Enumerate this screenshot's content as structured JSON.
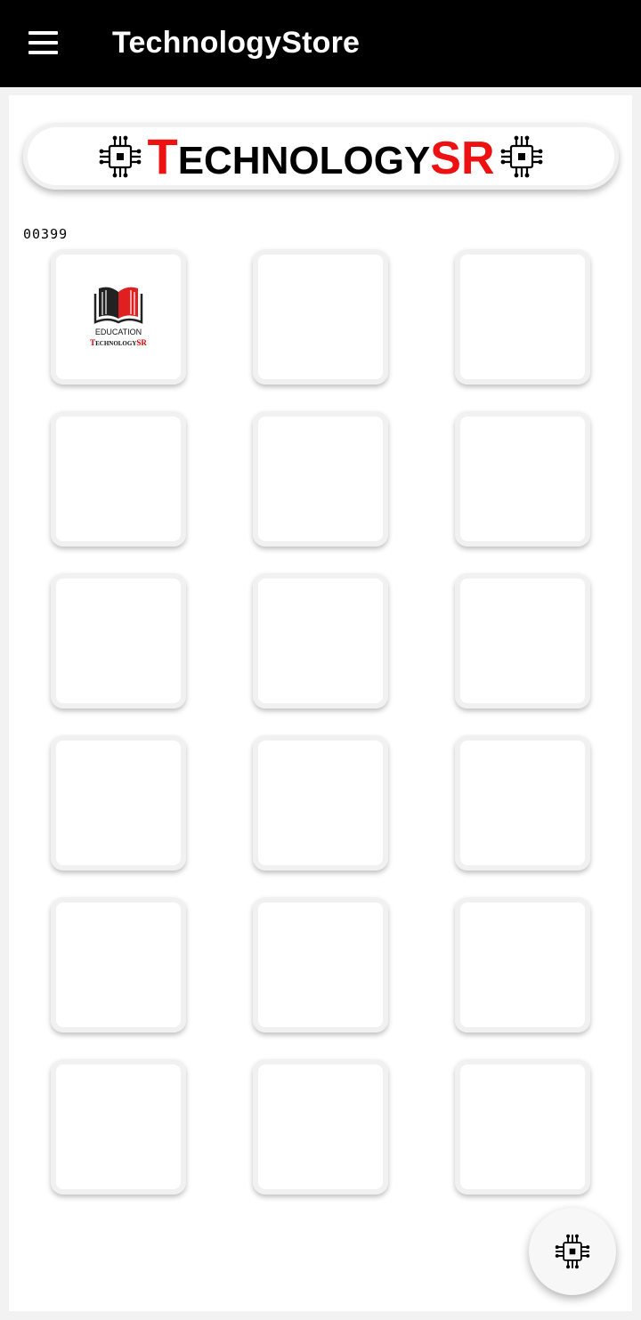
{
  "appbar": {
    "title": "TechnologyStore",
    "menu_icon": "hamburger-menu-icon"
  },
  "banner": {
    "brand_first_letter": "T",
    "brand_rest": "ECHNOLOGY",
    "brand_suffix": "SR",
    "left_icon": "circuit-chip-icon",
    "right_icon": "circuit-chip-icon",
    "accent_color": "#ee1111"
  },
  "counter": "00399",
  "grid": {
    "columns": 3,
    "rows": 6,
    "first_tile": {
      "icon": "open-book-icon",
      "line1": "EDUCATION",
      "line2_first": "T",
      "line2_mid": "ECHNOLOGY",
      "line2_suffix": "SR"
    }
  },
  "fab": {
    "icon": "circuit-chip-icon"
  }
}
